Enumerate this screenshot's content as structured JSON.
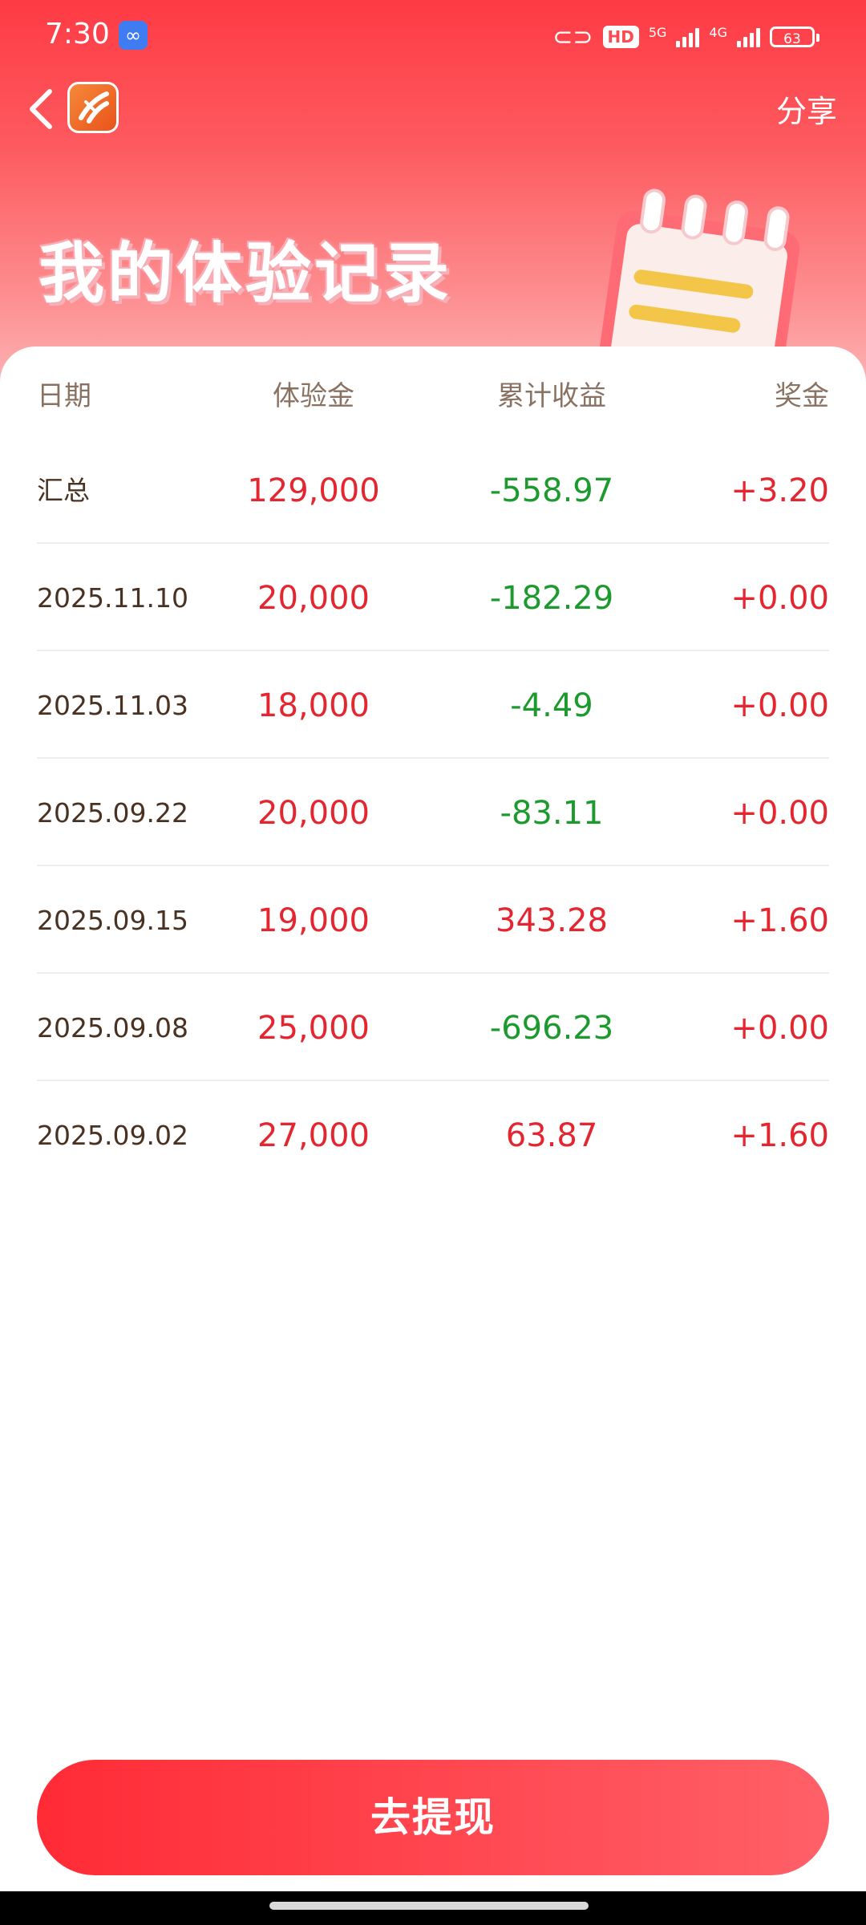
{
  "status_bar": {
    "time": "7:30",
    "hd_label": "HD",
    "net1": "5G",
    "net2": "4G",
    "battery": "63"
  },
  "header": {
    "share_label": "分享",
    "page_title": "我的体验记录"
  },
  "table": {
    "headers": [
      "日期",
      "体验金",
      "累计收益",
      "奖金"
    ],
    "rows": [
      {
        "date": "汇总",
        "amount": "129,000",
        "earnings": "-558.97",
        "bonus": "+3.20"
      },
      {
        "date": "2025.11.10",
        "amount": "20,000",
        "earnings": "-182.29",
        "bonus": "+0.00"
      },
      {
        "date": "2025.11.03",
        "amount": "18,000",
        "earnings": "-4.49",
        "bonus": "+0.00"
      },
      {
        "date": "2025.09.22",
        "amount": "20,000",
        "earnings": "-83.11",
        "bonus": "+0.00"
      },
      {
        "date": "2025.09.15",
        "amount": "19,000",
        "earnings": "343.28",
        "bonus": "+1.60"
      },
      {
        "date": "2025.09.08",
        "amount": "25,000",
        "earnings": "-696.23",
        "bonus": "+0.00"
      },
      {
        "date": "2025.09.02",
        "amount": "27,000",
        "earnings": "63.87",
        "bonus": "+1.60"
      }
    ]
  },
  "footer": {
    "withdraw_label": "去提现"
  },
  "colors": {
    "positive": "#e3262f",
    "negative": "#1c9a2e",
    "accent": "#fe3a44"
  }
}
